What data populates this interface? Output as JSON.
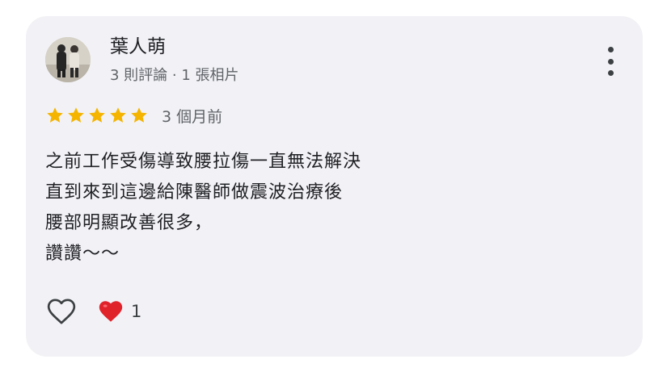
{
  "review": {
    "author_name": "葉人萌",
    "author_meta": "3 則評論 · 1 張相片",
    "rating": 5,
    "rating_max": 5,
    "time_ago": "3 個月前",
    "text_lines": [
      "之前工作受傷導致腰拉傷一直無法解決",
      "直到來到這邊給陳醫師做震波治療後",
      "腰部明顯改善很多，",
      "讚讚～～"
    ],
    "reaction_count": "1"
  },
  "icons": {
    "more": "more-vert-icon",
    "star": "star-icon",
    "like": "heart-outline-icon",
    "reaction": "red-heart-icon"
  },
  "colors": {
    "card_background": "#f2f2f6",
    "star": "#f4b400",
    "heart_red": "#e0222b",
    "secondary_text": "#5f6368"
  }
}
